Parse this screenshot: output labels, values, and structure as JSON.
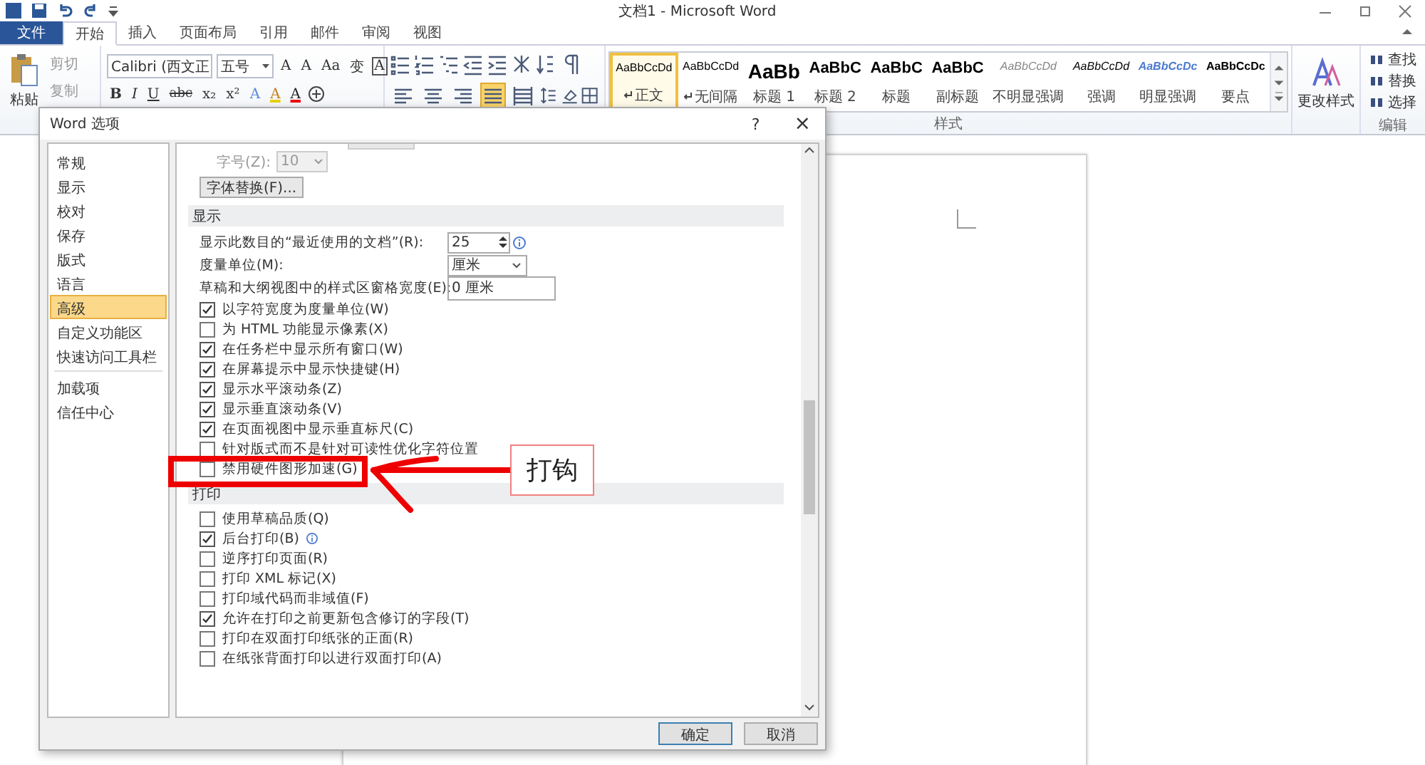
{
  "window": {
    "title": "文档1 - Microsoft Word"
  },
  "tabs": [
    {
      "label": "文件",
      "kind": "file",
      "selected": false
    },
    {
      "label": "开始",
      "kind": "tab",
      "selected": true
    },
    {
      "label": "插入",
      "kind": "tab",
      "selected": false
    },
    {
      "label": "页面布局",
      "kind": "tab",
      "selected": false
    },
    {
      "label": "引用",
      "kind": "tab",
      "selected": false
    },
    {
      "label": "邮件",
      "kind": "tab",
      "selected": false
    },
    {
      "label": "审阅",
      "kind": "tab",
      "selected": false
    },
    {
      "label": "视图",
      "kind": "tab",
      "selected": false
    }
  ],
  "clipboard": {
    "paste": "粘贴",
    "items": [
      {
        "label": "剪切",
        "disabled": true
      },
      {
        "label": "复制",
        "disabled": true
      }
    ]
  },
  "font": {
    "name": "Calibri (西文正",
    "size": "五号",
    "row1": [
      "A",
      "A",
      "Aa",
      "变",
      "A"
    ],
    "row2": [
      "B",
      "I",
      "U",
      "abc",
      "x₂",
      "x²"
    ],
    "row2b": [
      "A",
      "A",
      "A"
    ]
  },
  "paragraph": {
    "alignment": [
      {
        "selected": false
      },
      {
        "selected": false
      },
      {
        "selected": false
      },
      {
        "selected": true
      },
      {
        "selected": false
      }
    ]
  },
  "styles": {
    "label": "样式",
    "items": [
      {
        "preview": "AaBbCcDd",
        "name": "正文",
        "kind": "normal",
        "mark": true,
        "selected": true
      },
      {
        "preview": "AaBbCcDd",
        "name": "无间隔",
        "kind": "normal",
        "mark": true,
        "selected": false
      },
      {
        "preview": "AaBb",
        "name": "标题 1",
        "kind": "h1",
        "mark": false,
        "selected": false
      },
      {
        "preview": "AaBbC",
        "name": "标题 2",
        "kind": "h2",
        "mark": false,
        "selected": false
      },
      {
        "preview": "AaBbC",
        "name": "标题",
        "kind": "h2",
        "mark": false,
        "selected": false
      },
      {
        "preview": "AaBbC",
        "name": "副标题",
        "kind": "h2",
        "mark": false,
        "selected": false
      },
      {
        "preview": "AaBbCcDd",
        "name": "不明显强调",
        "kind": "subtle",
        "mark": false,
        "selected": false
      },
      {
        "preview": "AaBbCcDd",
        "name": "强调",
        "kind": "emphasis",
        "mark": false,
        "selected": false
      },
      {
        "preview": "AaBbCcDc",
        "name": "明显强调",
        "kind": "intense",
        "mark": false,
        "selected": false
      },
      {
        "preview": "AaBbCcDc",
        "name": "要点",
        "kind": "strong",
        "mark": false,
        "selected": false
      }
    ],
    "change": "更改样式"
  },
  "editing": {
    "label": "编辑",
    "items": [
      "查找",
      "替换",
      "选择"
    ]
  },
  "dialog": {
    "title": "Word 选项",
    "help": "?",
    "close": "×",
    "sidebar": [
      {
        "label": "常规",
        "selected": false
      },
      {
        "label": "显示",
        "selected": false
      },
      {
        "label": "校对",
        "selected": false
      },
      {
        "label": "保存",
        "selected": false
      },
      {
        "label": "版式",
        "selected": false
      },
      {
        "label": "语言",
        "selected": false
      },
      {
        "label": "高级",
        "selected": true
      },
      {
        "label": "自定义功能区",
        "selected": false
      },
      {
        "label": "快速访问工具栏",
        "selected": false
      },
      {
        "label": "加载项",
        "selected": false
      },
      {
        "label": "信任中心",
        "selected": false
      }
    ],
    "font_size": {
      "label": "字号(Z):",
      "value": "10",
      "disabled": true
    },
    "substitute_button": "字体替换(F)...",
    "display": {
      "heading": "显示",
      "fields": [
        {
          "label": "显示此数目的“最近使用的文档”(R):",
          "value": "25",
          "kind": "spin"
        },
        {
          "label": "度量单位(M):",
          "value": "厘米",
          "kind": "select"
        },
        {
          "label": "草稿和大纲视图中的样式区窗格宽度(E):",
          "value": "0 厘米",
          "kind": "text"
        }
      ],
      "options": [
        {
          "label": "以字符宽度为度量单位(W)",
          "checked": true
        },
        {
          "label": "为 HTML 功能显示像素(X)",
          "checked": false
        },
        {
          "label": "在任务栏中显示所有窗口(W)",
          "checked": true
        },
        {
          "label": "在屏幕提示中显示快捷键(H)",
          "checked": true
        },
        {
          "label": "显示水平滚动条(Z)",
          "checked": true
        },
        {
          "label": "显示垂直滚动条(V)",
          "checked": true
        },
        {
          "label": "在页面视图中显示垂直标尺(C)",
          "checked": true
        },
        {
          "label": "针对版式而不是针对可读性优化字符位置",
          "checked": false
        },
        {
          "label": "禁用硬件图形加速(G)",
          "checked": false
        }
      ]
    },
    "print": {
      "heading": "打印",
      "options": [
        {
          "label": "使用草稿品质(Q)",
          "checked": false
        },
        {
          "label": "后台打印(B)",
          "checked": true
        },
        {
          "label": "逆序打印页面(R)",
          "checked": false
        },
        {
          "label": "打印 XML 标记(X)",
          "checked": false
        },
        {
          "label": "打印域代码而非域值(F)",
          "checked": false
        },
        {
          "label": "允许在打印之前更新包含修订的字段(T)",
          "checked": true
        },
        {
          "label": "打印在双面打印纸张的正面(R)",
          "checked": false
        },
        {
          "label": "在纸张背面打印以进行双面打印(A)",
          "checked": false
        }
      ]
    },
    "buttons": [
      {
        "label": "确定",
        "kind": "default"
      },
      {
        "label": "取消",
        "kind": "normal"
      }
    ]
  },
  "annotation": {
    "text": "打钩"
  }
}
